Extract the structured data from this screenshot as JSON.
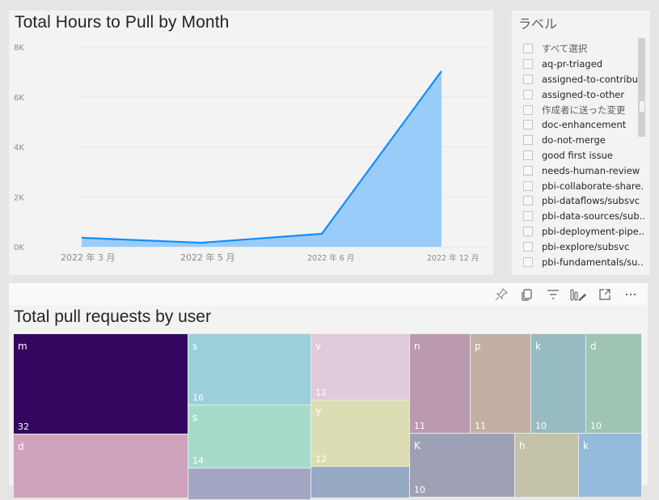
{
  "line_chart": {
    "title": "Total Hours to Pull by Month",
    "chart_data": {
      "type": "area",
      "title": "Total Hours to Pull by Month",
      "xlabel": "",
      "ylabel": "",
      "ylim": [
        0,
        8000
      ],
      "y_ticks": [
        "0K",
        "2K",
        "4K",
        "6K",
        "8K"
      ],
      "categories": [
        "2022 年 3 月",
        "2022 年 5 月",
        "2022 年 6 月",
        "2022 年 12 月"
      ],
      "values": [
        360,
        160,
        520,
        7030
      ],
      "grid": true,
      "line_color": "#118DFF",
      "fill_color": "#9ACCF9"
    }
  },
  "slicer": {
    "title": "ラベル",
    "items": [
      {
        "label": "すべて選択",
        "checked": false
      },
      {
        "label": "aq-pr-triaged",
        "checked": false
      },
      {
        "label": "assigned-to-contribu...",
        "checked": false
      },
      {
        "label": "assigned-to-other",
        "checked": false
      },
      {
        "label": "作成者に送った変更",
        "checked": false
      },
      {
        "label": "doc-enhancement",
        "checked": false
      },
      {
        "label": "do-not-merge",
        "checked": false
      },
      {
        "label": "good first issue",
        "checked": false
      },
      {
        "label": "needs-human-review",
        "checked": false
      },
      {
        "label": "pbi-collaborate-share...",
        "checked": false
      },
      {
        "label": "pbi-dataflows/subsvc",
        "checked": false
      },
      {
        "label": "pbi-data-sources/sub...",
        "checked": false
      },
      {
        "label": "pbi-deployment-pipe...",
        "checked": false
      },
      {
        "label": "pbi-explore/subsvc",
        "checked": false
      },
      {
        "label": "pbi-fundamentals/su...",
        "checked": false
      }
    ]
  },
  "visual_header": {
    "icons": [
      "pin-icon",
      "copy-icon",
      "filter-icon",
      "format-visual-icon",
      "focus-mode-icon",
      "more-options-icon"
    ]
  },
  "treemap": {
    "title": "Total pull requests by user",
    "chart_data": {
      "type": "treemap",
      "title": "Total pull requests by user",
      "items": [
        {
          "label": "m",
          "value": 32,
          "color": "#35065F"
        },
        {
          "label": "d",
          "value": null,
          "color": "#CFA3BC"
        },
        {
          "label": "s",
          "value": 16,
          "color": "#9BD0DA"
        },
        {
          "label": "s",
          "value": 14,
          "color": "#A6DBCB"
        },
        {
          "label": "",
          "value": null,
          "color": "#A2A8C3"
        },
        {
          "label": "v",
          "value": 12,
          "color": "#E0CADB"
        },
        {
          "label": "Y",
          "value": 12,
          "color": "#DDDDB3"
        },
        {
          "label": "",
          "value": null,
          "color": "#96ABC3"
        },
        {
          "label": "n",
          "value": 11,
          "color": "#BB9AAF"
        },
        {
          "label": "p",
          "value": 11,
          "color": "#C4AFA5"
        },
        {
          "label": "k",
          "value": 10,
          "color": "#97BBC2"
        },
        {
          "label": "d",
          "value": 10,
          "color": "#9EC4B4"
        },
        {
          "label": "K",
          "value": 10,
          "color": "#9EA1B6"
        },
        {
          "label": "h",
          "value": null,
          "color": "#C4C3A9"
        },
        {
          "label": "k",
          "value": null,
          "color": "#94BADB"
        }
      ]
    }
  }
}
